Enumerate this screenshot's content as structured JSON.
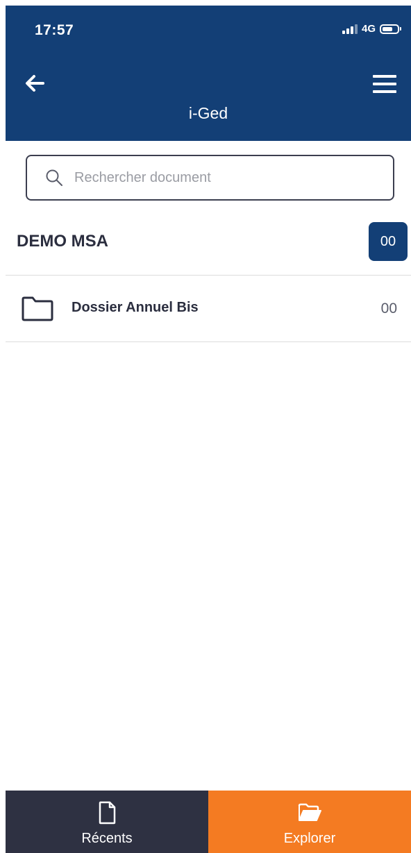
{
  "status_bar": {
    "time": "17:57",
    "network": "4G"
  },
  "header": {
    "title": "i-Ged",
    "back_icon": "arrow-left-icon",
    "menu_icon": "hamburger-menu-icon"
  },
  "search": {
    "placeholder": "Rechercher document",
    "value": ""
  },
  "section": {
    "title": "DEMO MSA",
    "count": "00"
  },
  "folders": [
    {
      "name": "Dossier Annuel Bis",
      "count": "00",
      "icon": "folder-icon"
    }
  ],
  "bottom_nav": {
    "items": [
      {
        "label": "Récents",
        "icon": "document-icon",
        "active": false
      },
      {
        "label": "Explorer",
        "icon": "folder-open-icon",
        "active": true
      }
    ]
  },
  "colors": {
    "header_bg": "#133f76",
    "accent": "#f47b22",
    "nav_dark": "#2e3142",
    "text_dark": "#2b2e3f"
  }
}
